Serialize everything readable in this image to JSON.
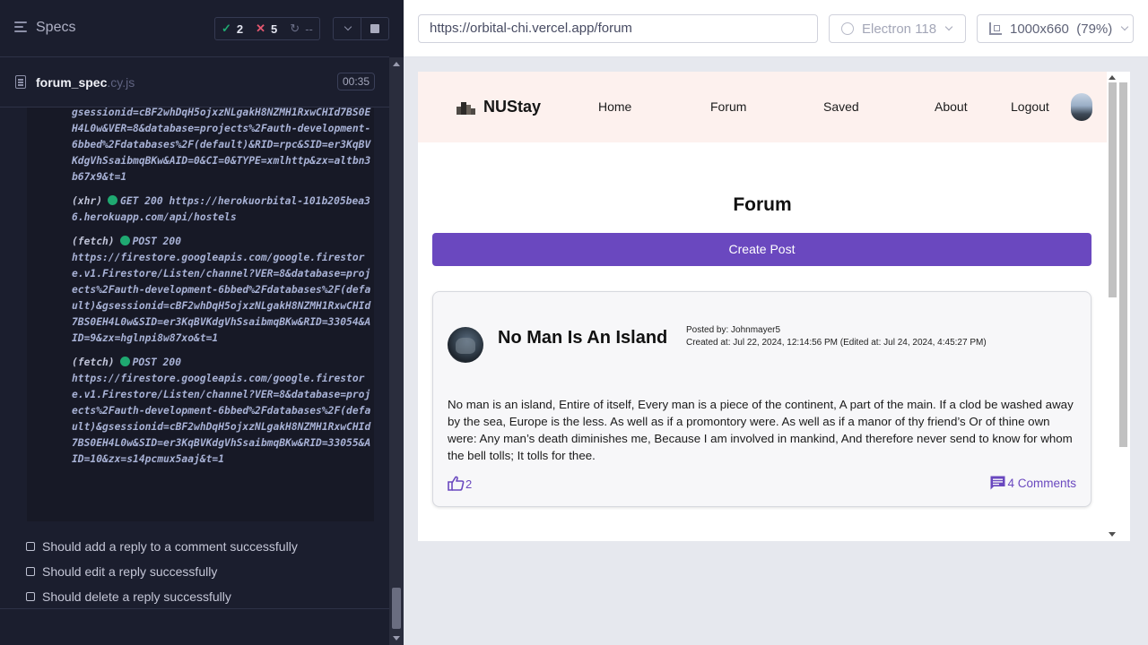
{
  "reporter": {
    "specs_label": "Specs",
    "stats": {
      "passed": "2",
      "failed": "5",
      "pending": "--"
    },
    "spec": {
      "name": "forum_spec",
      "ext": ".cy.js",
      "duration": "00:35"
    },
    "log": {
      "top_fragment": "gsessionid=cBF2whDqH5ojxzNLgakH8NZMH1RxwCHId7BS0EH4L0w&VER=8&database=projects%2Fauth-development-6bbed%2Fdatabases%2F(default)&RID=rpc&SID=er3KqBVKdgVhSsaibmqBKw&AID=0&CI=0&TYPE=xmlhttp&zx=altbn3b67x9&t=1",
      "entries": [
        {
          "type": "(xhr)",
          "status": "GET 200",
          "url": "https://herokuorbital-101b205bea36.herokuapp.com/api/hostels"
        },
        {
          "type": "(fetch)",
          "status": "POST 200",
          "url": "https://firestore.googleapis.com/google.firestore.v1.Firestore/Listen/channel?VER=8&database=projects%2Fauth-development-6bbed%2Fdatabases%2F(default)&gsessionid=cBF2whDqH5ojxzNLgakH8NZMH1RxwCHId7BS0EH4L0w&SID=er3KqBVKdgVhSsaibmqBKw&RID=33054&AID=9&zx=hglnpi8w87xo&t=1"
        },
        {
          "type": "(fetch)",
          "status": "POST 200",
          "url": "https://firestore.googleapis.com/google.firestore.v1.Firestore/Listen/channel?VER=8&database=projects%2Fauth-development-6bbed%2Fdatabases%2F(default)&gsessionid=cBF2whDqH5ojxzNLgakH8NZMH1RxwCHId7BS0EH4L0w&SID=er3KqBVKdgVhSsaibmqBKw&RID=33055&AID=10&zx=s14pcmux5aaj&t=1"
        }
      ]
    },
    "tests": [
      "Should add a reply to a comment successfully",
      "Should edit a reply successfully",
      "Should delete a reply successfully"
    ]
  },
  "browser_bar": {
    "url": "https://orbital-chi.vercel.app/forum",
    "browser": "Electron 118",
    "viewport": "1000x660  (79%)"
  },
  "app": {
    "brand": "NUStay",
    "nav": {
      "home": "Home",
      "forum": "Forum",
      "saved": "Saved",
      "about": "About",
      "logout": "Logout"
    },
    "page_title": "Forum",
    "create_post_label": "Create Post",
    "post": {
      "title": "No Man Is An Island",
      "posted_by": "Posted by: Johnmayer5",
      "created_at": "Created at: Jul 22, 2024, 12:14:56 PM (Edited at: Jul 24, 2024, 4:45:27 PM)",
      "body": "No man is an island, Entire of itself, Every man is a piece of the continent, A part of the main. If a clod be washed away by the sea, Europe is the less. As well as if a promontory were. As well as if a manor of thy friend’s Or of thine own were: Any man’s death diminishes me, Because I am involved in mankind, And therefore never send to know for whom the bell tolls; It tolls for thee.",
      "likes": "2",
      "comments_label": "4 Comments"
    }
  },
  "colors": {
    "accent": "#6a48bf",
    "pass": "#1fa971",
    "fail": "#e45770",
    "reporter_bg": "#1b1e2e",
    "navbar_bg": "#fdf1ee"
  }
}
